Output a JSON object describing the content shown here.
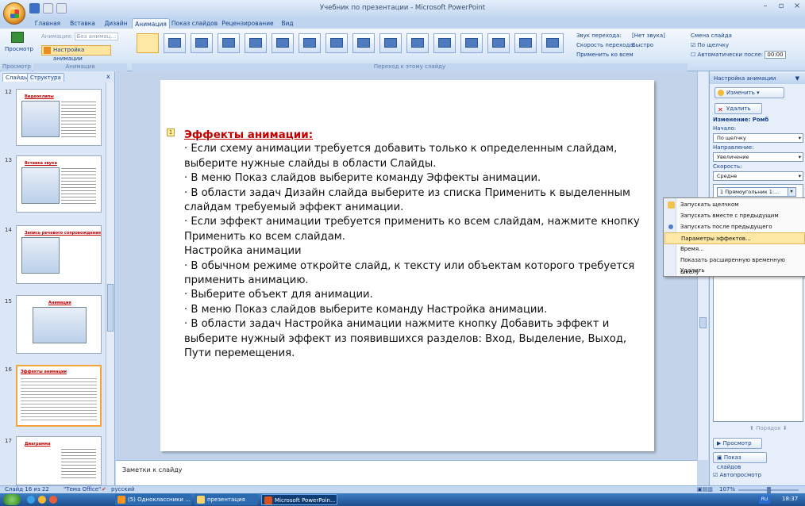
{
  "window": {
    "title": "Учебник по презентации - Microsoft PowerPoint"
  },
  "ribbon_tabs": [
    "Главная",
    "Вставка",
    "Дизайн",
    "Анимация",
    "Показ слайдов",
    "Рецензирование",
    "Вид"
  ],
  "ribbon": {
    "preview_label": "Просмотр",
    "preview_group": "Просмотр",
    "animation_dropdown_label": "Анимация:",
    "animation_dropdown_value": "Без анимац...",
    "custom_animation": "Настройка анимации",
    "animation_group": "Анимация",
    "transition_group": "Переход к этому слайду",
    "sound_label": "Звук перехода:",
    "sound_value": "[Нет звука]",
    "speed_label": "Скорость перехода:",
    "speed_value": "Быстро",
    "apply_all": "Применить ко всем",
    "advance_header": "Смена слайда",
    "on_click": "По щелчку",
    "auto_after": "Автоматически после:",
    "auto_time": "00:00"
  },
  "left_panel": {
    "tabs": [
      "Слайды",
      "Структура"
    ],
    "close": "x",
    "slides": [
      {
        "num": "12",
        "title": "Видеоклипы"
      },
      {
        "num": "13",
        "title": "Вставка звука"
      },
      {
        "num": "14",
        "title": "Запись речевого сопровождения"
      },
      {
        "num": "15",
        "title": "Анимация"
      },
      {
        "num": "16",
        "title": "Эффекты анимации"
      },
      {
        "num": "17",
        "title": "Диаграмма"
      }
    ]
  },
  "slide": {
    "marker": "1",
    "title": "Эффекты анимации:",
    "lines": [
      "· Если схему анимации требуется добавить только к определенным слайдам, выберите нужные слайды в области Слайды.",
      "· В меню Показ слайдов выберите команду Эффекты анимации.",
      "· В области задач Дизайн слайда выберите из списка Применить к выделенным слайдам требуемый эффект анимации.",
      "· Если эффект анимации требуется применить ко всем слайдам, нажмите кнопку Применить ко всем слайдам.",
      "Настройка анимации",
      "· В обычном режиме откройте слайд, к тексту или объектам которого требуется применить анимацию.",
      "· Выберите объект для анимации.",
      "· В меню Показ слайдов выберите команду Настройка анимации.",
      "· В области задач Настройка анимации нажмите кнопку Добавить эффект и выберите нужный эффект из появившихся разделов: Вход, Выделение, Выход, Пути перемещения."
    ]
  },
  "notes": {
    "placeholder": "Заметки к слайду"
  },
  "taskpane": {
    "title": "Настройка анимации",
    "change_button": "Изменить",
    "delete_button": "Удалить",
    "change_header": "Изменение: Ромб",
    "start_label": "Начало:",
    "start_value": "По щелчку",
    "direction_label": "Направление:",
    "direction_value": "Увеличение",
    "speed_label": "Скорость:",
    "speed_value": "Средне",
    "list_item": "1  Прямоугольник 1:...",
    "order_label": "Порядок",
    "preview_button": "Просмотр",
    "slideshow_button": "Показ слайдов",
    "autopreview": "Автопросмотр"
  },
  "context_menu": {
    "items": [
      "Запускать щелчком",
      "Запускать вместе с предыдущим",
      "Запускать после предыдущего",
      "Параметры эффектов...",
      "Время...",
      "Показать расширенную временную шкалу",
      "Удалить"
    ],
    "highlighted": 3
  },
  "statusbar": {
    "slide_info": "Слайд 16 из 22",
    "theme": "\"Тема Office\"",
    "language": "русский",
    "zoom": "107%"
  },
  "taskbar": {
    "items": [
      "(5) Одноклассники ...",
      "презентация",
      "Microsoft PowerPoin..."
    ],
    "lang": "RU",
    "clock": "18:37"
  }
}
